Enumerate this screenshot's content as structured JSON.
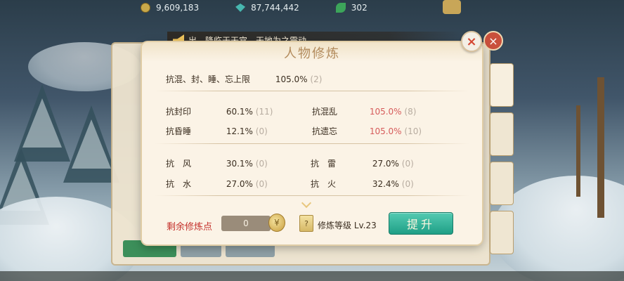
{
  "resources": [
    {
      "icon": "coin-icon",
      "value": "9,609,183"
    },
    {
      "icon": "gem-icon",
      "value": "87,744,442"
    },
    {
      "icon": "leaf-icon",
      "value": "302"
    }
  ],
  "broadcast": {
    "text": "出，降临于天宫，天地为之震动。"
  },
  "dialog": {
    "title": "人物修炼",
    "overall": {
      "label": "抗混、封、睡、忘上限",
      "value": "105.0%",
      "extra": "(2)"
    },
    "control_left": [
      {
        "label": "抗封印",
        "value": "60.1%",
        "extra": "(11)"
      },
      {
        "label": "抗昏睡",
        "value": "12.1%",
        "extra": "(0)"
      }
    ],
    "control_right": [
      {
        "label": "抗混乱",
        "value": "105.0%",
        "extra": "(8)"
      },
      {
        "label": "抗遗忘",
        "value": "105.0%",
        "extra": "(10)"
      }
    ],
    "element_left": [
      {
        "label": "抗　风",
        "value": "30.1%",
        "extra": "(0)"
      },
      {
        "label": "抗　水",
        "value": "27.0%",
        "extra": "(0)"
      }
    ],
    "element_right": [
      {
        "label": "抗　雷",
        "value": "27.0%",
        "extra": "(0)"
      },
      {
        "label": "抗　火",
        "value": "32.4%",
        "extra": "(0)"
      }
    ],
    "remaining_label": "剩余修炼点",
    "remaining_value": "0",
    "level_label": "修炼等级 Lv.23",
    "upgrade_button": "提升"
  },
  "colors": {
    "accent": "#1f9f86",
    "highlight": "#d65b5b",
    "remaining": "#c4302b"
  }
}
